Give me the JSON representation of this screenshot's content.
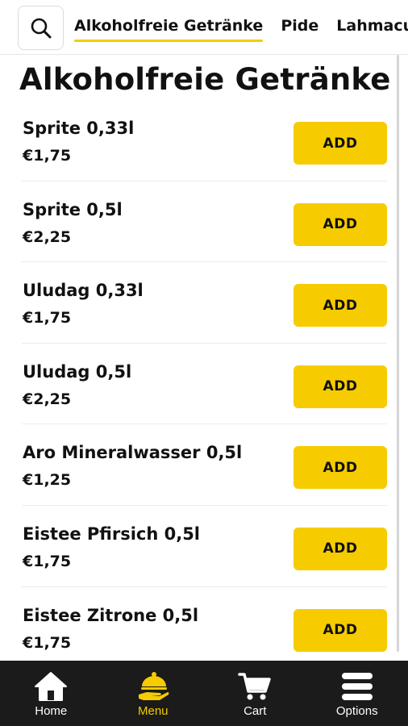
{
  "header": {
    "search_icon": "search-icon",
    "tabs": [
      {
        "label": "Alkoholfreie Getränke",
        "active": true
      },
      {
        "label": "Pide",
        "active": false
      },
      {
        "label": "Lahmacun",
        "active": false
      }
    ]
  },
  "section": {
    "title": "Alkoholfreie Getränke"
  },
  "items": [
    {
      "name": "Sprite 0,33l",
      "price": "€1,75",
      "button": "ADD"
    },
    {
      "name": "Sprite 0,5l",
      "price": "€2,25",
      "button": "ADD"
    },
    {
      "name": "Uludag 0,33l",
      "price": "€1,75",
      "button": "ADD"
    },
    {
      "name": "Uludag 0,5l",
      "price": "€2,25",
      "button": "ADD"
    },
    {
      "name": "Aro Mineralwasser 0,5l",
      "price": "€1,25",
      "button": "ADD"
    },
    {
      "name": "Eistee Pfirsich 0,5l",
      "price": "€1,75",
      "button": "ADD"
    },
    {
      "name": "Eistee Zitrone 0,5l",
      "price": "€1,75",
      "button": "ADD"
    }
  ],
  "bottom_nav": {
    "items": [
      {
        "label": "Home",
        "icon": "home-icon",
        "active": false
      },
      {
        "label": "Menu",
        "icon": "serving-cloche-icon",
        "active": true
      },
      {
        "label": "Cart",
        "icon": "cart-icon",
        "active": false
      },
      {
        "label": "Options",
        "icon": "hamburger-menu-icon",
        "active": false
      }
    ]
  },
  "colors": {
    "accent": "#f6cc00",
    "nav_background": "#1b1b1b",
    "text": "#111111"
  }
}
